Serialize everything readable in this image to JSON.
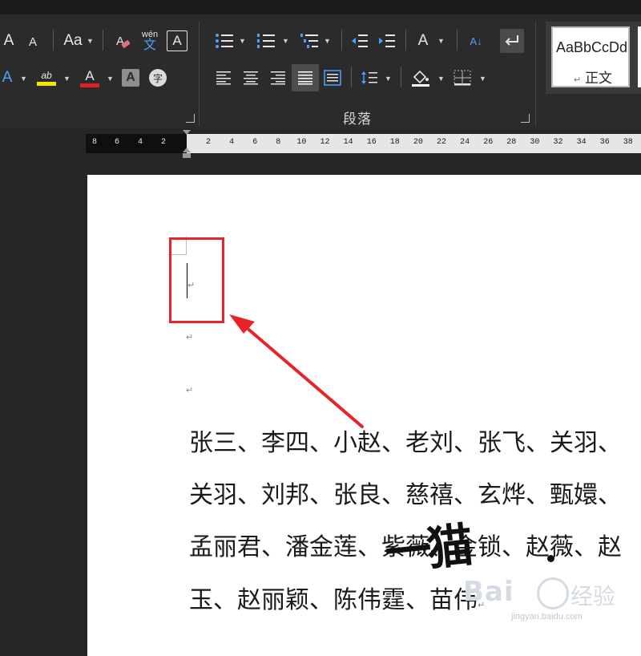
{
  "ribbon": {
    "font_row1": [
      "A",
      "A",
      "Aa"
    ],
    "phonetic_label": "wén",
    "phonetic_char": "文",
    "border_char": "A",
    "shade_char": "A",
    "enclose_char": "字",
    "highlight_label": "ab",
    "font_color_char": "A",
    "paragraph_group_label": "段落",
    "sort_label": "A↓",
    "style_preview_text": "AaBbCcDd",
    "style_normal_name": "正文",
    "accent_yellow": "#f5e500",
    "accent_red": "#e02020",
    "accent_blue": "#4aa3ff"
  },
  "ruler": {
    "left_numbers": [
      "8",
      "6",
      "4",
      "2"
    ],
    "right_numbers": [
      "2",
      "4",
      "6",
      "8",
      "10",
      "12",
      "14",
      "16",
      "18",
      "20",
      "22",
      "24",
      "26",
      "28",
      "30",
      "32",
      "34",
      "36",
      "38"
    ]
  },
  "document": {
    "paragraph_mark": "↵",
    "lines": [
      "张三、李四、小赵、老刘、张飞、关羽、",
      "关羽、刘邦、张良、慈禧、玄烨、甄嬛、",
      "孟丽君、潘金莲、紫薇、金锁、赵薇、赵",
      "玉、赵丽颖、陈伟霆、苗伟"
    ]
  },
  "annotation": {
    "color": "#e8242a"
  },
  "signature": {
    "text": "一猫"
  },
  "watermark": {
    "brand": "Bai",
    "cn": "经验",
    "url": "jingyan.baidu.com"
  }
}
